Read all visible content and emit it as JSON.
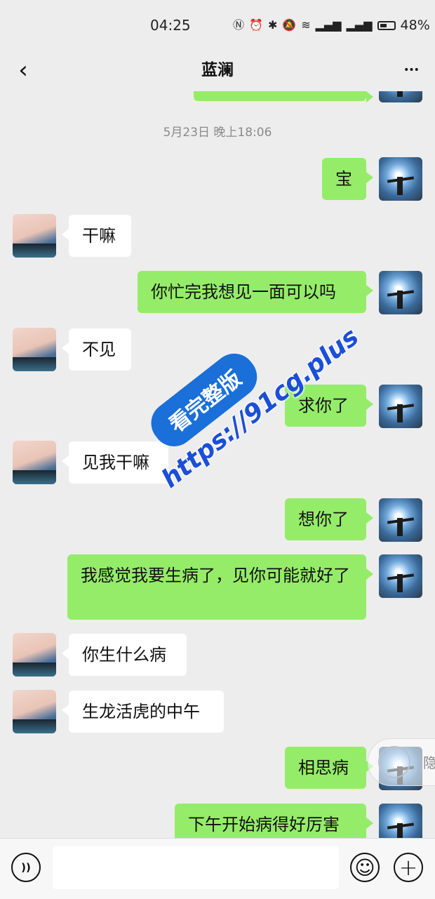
{
  "status_bar": {
    "time": "04:25",
    "icons": [
      "nfc-icon",
      "alarm-icon",
      "bluetooth-icon",
      "mute-icon",
      "wifi-icon",
      "signal-5g-icon",
      "signal-4g-icon"
    ],
    "battery_text": "48%",
    "battery_level": 0.48
  },
  "nav": {
    "title": "蓝澜",
    "back_glyph": "‹",
    "more_glyph": "•••"
  },
  "chat": {
    "timestamp": "5月23日 晚上18:06",
    "messages": [
      {
        "from": "me",
        "text": "宝"
      },
      {
        "from": "her",
        "text": "干嘛"
      },
      {
        "from": "me",
        "text": "你忙完我想见一面可以吗"
      },
      {
        "from": "her",
        "text": "不见"
      },
      {
        "from": "me",
        "text": "求你了"
      },
      {
        "from": "her",
        "text": "见我干嘛"
      },
      {
        "from": "me",
        "text": "想你了"
      },
      {
        "from": "me",
        "text": "我感觉我要生病了，见你可能就好了"
      },
      {
        "from": "her",
        "text": "你生什么病"
      },
      {
        "from": "her",
        "text": "生龙活虎的中午"
      },
      {
        "from": "me",
        "text": "相思病"
      },
      {
        "from": "me",
        "text": "下午开始病得好厉害"
      }
    ]
  },
  "watermark": {
    "badge": "看完整版",
    "url": "https://91cg.plus"
  },
  "floating_chip": {
    "label": "隐"
  },
  "input_bar": {
    "placeholder": "",
    "emoji_glyph": "☺",
    "plus_glyph": "+",
    "voice_glyph": "))"
  },
  "colors": {
    "background": "#ededed",
    "my_bubble": "#95ec69",
    "her_bubble": "#ffffff",
    "watermark_blue": "#1a6fd8"
  }
}
